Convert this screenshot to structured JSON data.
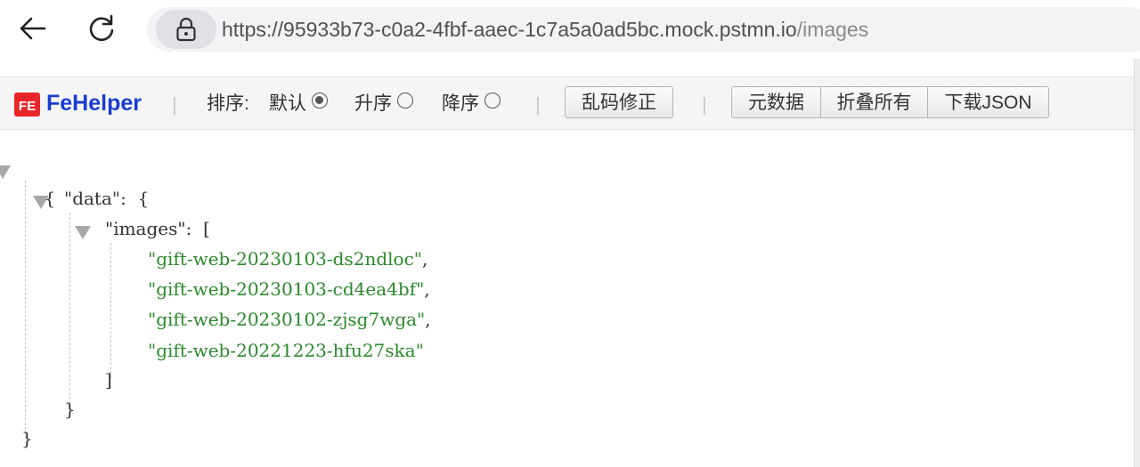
{
  "browser": {
    "url_main": "https://95933b73-c0a2-4fbf-aaec-1c7a5a0ad5bc.mock.pstmn.io",
    "url_path": "/images"
  },
  "toolbar": {
    "brand": "FeHelper",
    "logo_text": "FE",
    "separator": "|",
    "sort_label": "排序:",
    "sort_options": [
      {
        "label": "默认",
        "checked": true
      },
      {
        "label": "升序",
        "checked": false
      },
      {
        "label": "降序",
        "checked": false
      }
    ],
    "fix_encoding_label": "乱码修正",
    "metadata_label": "元数据",
    "collapse_all_label": "折叠所有",
    "download_json_label": "下载JSON"
  },
  "json": {
    "open_brace": "{",
    "close_brace": "}",
    "data_key": "\"data\"",
    "colon": ":",
    "data_open": "{",
    "data_close": "}",
    "images_key": "\"images\"",
    "images_open": "[",
    "images_close": "]",
    "images": [
      "\"gift-web-20230103-ds2ndloc\"",
      "\"gift-web-20230103-cd4ea4bf\"",
      "\"gift-web-20230102-zjsg7wga\"",
      "\"gift-web-20221223-hfu27ska\""
    ],
    "comma": ","
  },
  "colors": {
    "brand": "#1a3cd0",
    "string": "#2a8a2a",
    "toolbar_bg": "#f5f5f5"
  },
  "icons": {
    "back": "arrow-left-icon",
    "reload": "reload-icon",
    "lock": "lock-icon"
  }
}
